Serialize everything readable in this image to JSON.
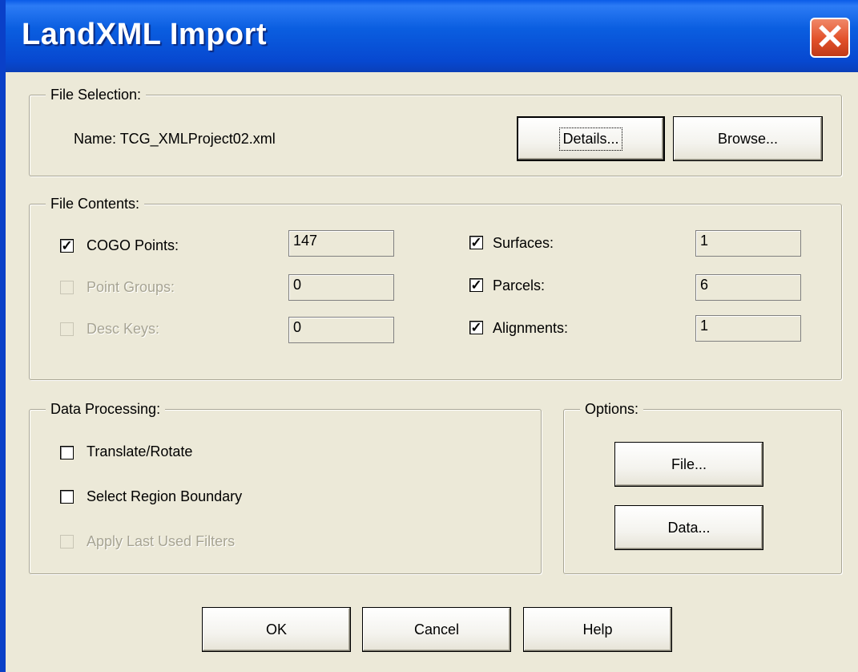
{
  "window": {
    "title": "LandXML Import",
    "close_glyph": "✕"
  },
  "file_selection": {
    "legend": "File Selection:",
    "name_label": "Name: TCG_XMLProject02.xml",
    "details_button": "Details...",
    "browse_button": "Browse..."
  },
  "file_contents": {
    "legend": "File Contents:",
    "items": [
      {
        "label": "COGO Points:",
        "checked": true,
        "enabled": true,
        "value": "147"
      },
      {
        "label": "Point Groups:",
        "checked": false,
        "enabled": false,
        "value": "0"
      },
      {
        "label": "Desc Keys:",
        "checked": false,
        "enabled": false,
        "value": "0"
      },
      {
        "label": "Surfaces:",
        "checked": true,
        "enabled": true,
        "value": "1"
      },
      {
        "label": "Parcels:",
        "checked": true,
        "enabled": true,
        "value": "6"
      },
      {
        "label": "Alignments:",
        "checked": true,
        "enabled": true,
        "value": "1"
      }
    ]
  },
  "data_processing": {
    "legend": "Data Processing:",
    "items": [
      {
        "label": "Translate/Rotate",
        "checked": false,
        "enabled": true
      },
      {
        "label": "Select Region Boundary",
        "checked": false,
        "enabled": true
      },
      {
        "label": "Apply Last Used Filters",
        "checked": false,
        "enabled": false
      }
    ]
  },
  "options": {
    "legend": "Options:",
    "file_button": "File...",
    "data_button": "Data..."
  },
  "footer": {
    "ok": "OK",
    "cancel": "Cancel",
    "help": "Help"
  },
  "colors": {
    "titlebar": "#0A5EE0",
    "dialog_bg": "#ECE9D8",
    "close_button": "#E2512A",
    "disabled_text": "#A7A493"
  },
  "icons": {
    "close": "close-icon",
    "check": "check-icon"
  }
}
